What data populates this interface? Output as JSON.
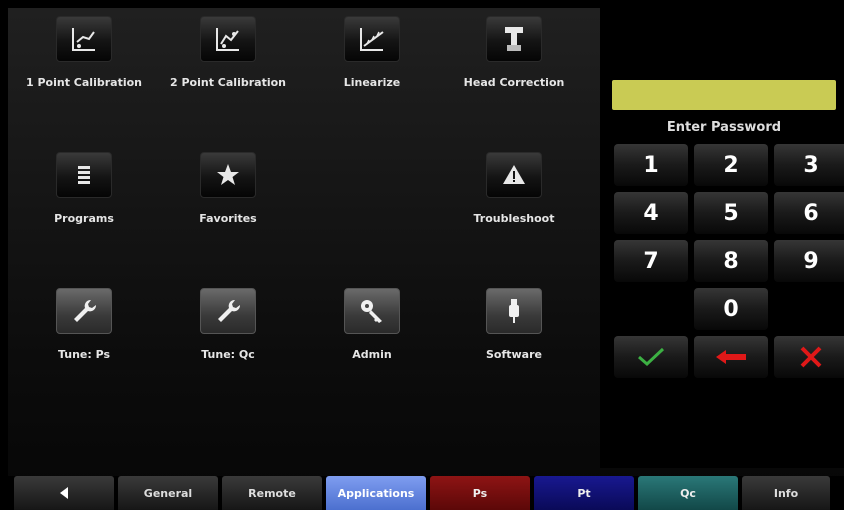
{
  "apps": [
    {
      "label": "1 Point Calibration",
      "icon": "one-point-calibration-icon"
    },
    {
      "label": "2 Point Calibration",
      "icon": "two-point-calibration-icon"
    },
    {
      "label": "Linearize",
      "icon": "linearize-icon"
    },
    {
      "label": "Head Correction",
      "icon": "head-correction-icon"
    },
    {
      "label": "Programs",
      "icon": "list-icon"
    },
    {
      "label": "Favorites",
      "icon": "star-icon"
    },
    {
      "label": "Troubleshoot",
      "icon": "warning-icon"
    },
    {
      "label": "Tune: Ps",
      "icon": "wrench-icon"
    },
    {
      "label": "Tune: Qc",
      "icon": "wrench-icon"
    },
    {
      "label": "Admin",
      "icon": "key-icon"
    },
    {
      "label": "Software",
      "icon": "usb-icon"
    }
  ],
  "keypad": {
    "password_prompt": "Enter Password",
    "keys": [
      "1",
      "2",
      "3",
      "4",
      "5",
      "6",
      "7",
      "8",
      "9",
      "0"
    ],
    "confirm_icon": "checkmark-icon",
    "backspace_icon": "backspace-arrow-icon",
    "cancel_icon": "cancel-x-icon",
    "field_color": "#c9cb54"
  },
  "tabs": [
    {
      "label": "",
      "icon": "back-arrow-icon",
      "color": "#2a2a2a"
    },
    {
      "label": "General",
      "color": "#2a2a2a"
    },
    {
      "label": "Remote",
      "color": "#2a2a2a"
    },
    {
      "label": "Applications",
      "color": "#5a7fd8",
      "active": true
    },
    {
      "label": "Ps",
      "color": "#7a1010"
    },
    {
      "label": "Pt",
      "color": "#10106a"
    },
    {
      "label": "Qc",
      "color": "#1a6060"
    },
    {
      "label": "Info",
      "color": "#2a2a2a"
    }
  ]
}
